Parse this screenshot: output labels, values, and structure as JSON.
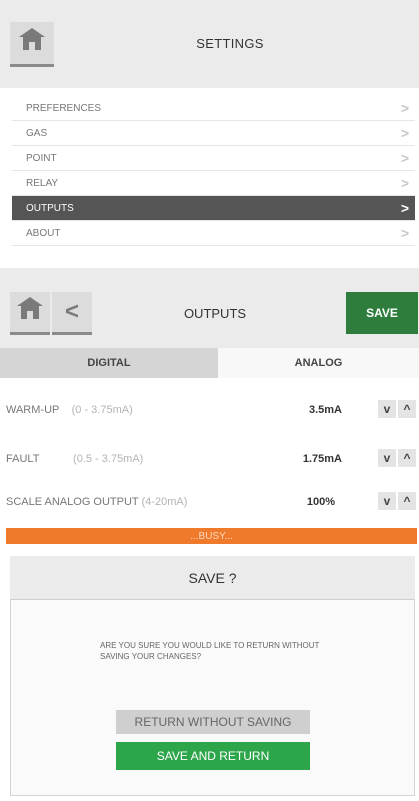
{
  "settings": {
    "title": "SETTINGS",
    "menu": [
      {
        "label": "PREFERENCES",
        "active": false
      },
      {
        "label": "GAS",
        "active": false
      },
      {
        "label": "POINT",
        "active": false
      },
      {
        "label": "RELAY",
        "active": false
      },
      {
        "label": "OUTPUTS",
        "active": true
      },
      {
        "label": "ABOUT",
        "active": false
      }
    ],
    "chevron": ">"
  },
  "outputs": {
    "title": "OUTPUTS",
    "save_label": "SAVE",
    "back_glyph": "<",
    "tabs": {
      "digital": "DIGITAL",
      "analog": "ANALOG"
    },
    "active_tab": "ANALOG",
    "rows": [
      {
        "label": "WARM-UP",
        "range": "(0 - 3.75mA)",
        "value": "3.5mA"
      },
      {
        "label": "FAULT",
        "range": "(0.5 - 3.75mA)",
        "value": "1.75mA"
      },
      {
        "label": "SCALE ANALOG OUTPUT",
        "range": "(4-20mA)",
        "value": "100%"
      }
    ],
    "stepper": {
      "down": "v",
      "up": "^"
    },
    "busy_text": "...BUSY..."
  },
  "dialog": {
    "title": "SAVE ?",
    "message": "ARE YOU SURE YOU WOULD LIKE TO RETURN WITHOUT SAVING YOUR CHANGES?",
    "return_label": "RETURN WITHOUT SAVING",
    "save_label": "SAVE AND RETURN"
  },
  "colors": {
    "accent_green": "#2e7d3c",
    "button_green": "#2da54a",
    "busy_orange": "#f07a2b",
    "menu_active": "#555555"
  }
}
